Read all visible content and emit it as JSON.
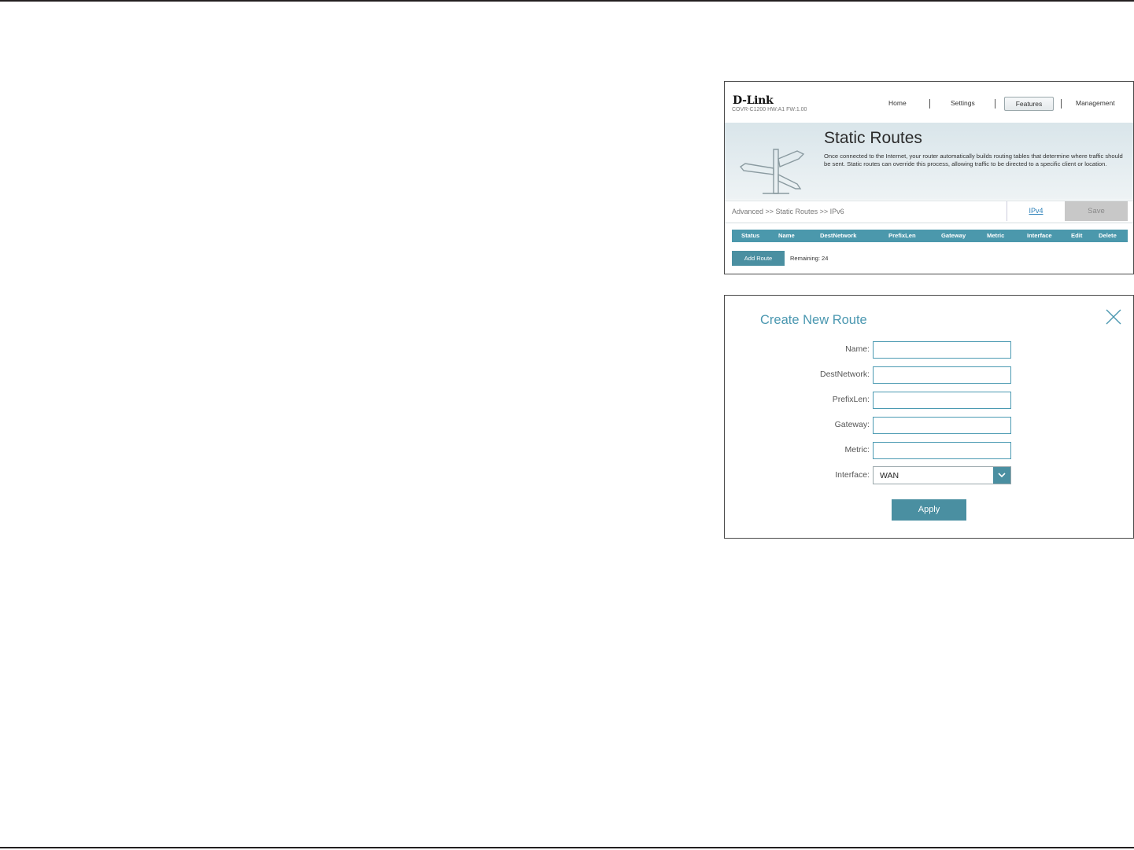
{
  "router_page": {
    "brand": "D-Link",
    "model": "COVR-C1200 HW:A1 FW:1.00",
    "nav": {
      "home": "Home",
      "settings": "Settings",
      "features": "Features",
      "management": "Management"
    },
    "title": "Static Routes",
    "description": "Once connected to the Internet, your router automatically builds routing tables that determine where traffic should be sent. Static routes can override this process, allowing traffic to be directed to a specific client or location.",
    "breadcrumb": "Advanced >> Static Routes >> IPv6",
    "ipv4_link": "IPv4",
    "save_label": "Save",
    "columns": [
      "Status",
      "Name",
      "DestNetwork",
      "PrefixLen",
      "Gateway",
      "Metric",
      "Interface",
      "Edit",
      "Delete"
    ],
    "add_route_label": "Add Route",
    "remaining": "Remaining: 24",
    "accent_color": "#4b98ac"
  },
  "create_route": {
    "title": "Create New Route",
    "labels": {
      "name": "Name:",
      "dest_network": "DestNetwork:",
      "prefix_len": "PrefixLen:",
      "gateway": "Gateway:",
      "metric": "Metric:",
      "interface": "Interface:"
    },
    "values": {
      "name": "",
      "dest_network": "",
      "prefix_len": "",
      "gateway": "",
      "metric": ""
    },
    "interface_value": "WAN",
    "apply_label": "Apply",
    "title_color": "#4a97b0"
  }
}
